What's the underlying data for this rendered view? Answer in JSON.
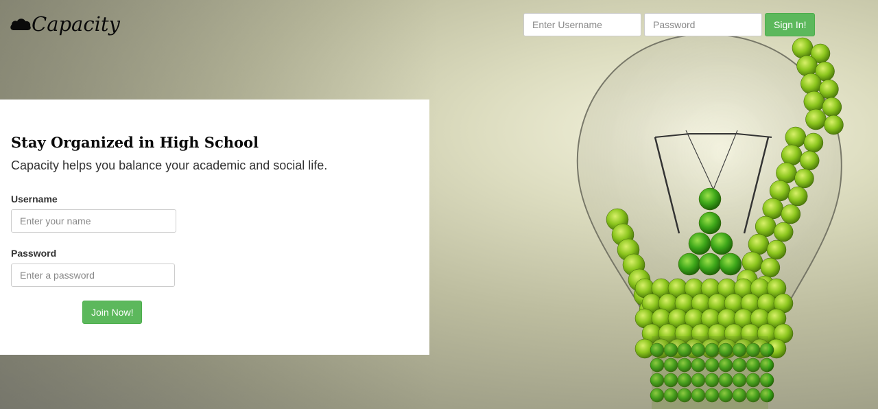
{
  "header": {
    "brand": "Capacity",
    "username_placeholder": "Enter Username",
    "password_placeholder": "Password",
    "signin_label": "Sign In!"
  },
  "signup": {
    "title": "Stay Organized in High School",
    "subtitle": "Capacity helps you balance your academic and social life.",
    "username_label": "Username",
    "username_placeholder": "Enter your name",
    "password_label": "Password",
    "password_placeholder": "Enter a password",
    "join_label": "Join Now!"
  },
  "icons": {
    "brand_icon": "cloud-icon",
    "hero_image": "lightbulb-apples-image"
  },
  "colors": {
    "accent": "#5cb85c",
    "accent_border": "#4cae4c"
  }
}
